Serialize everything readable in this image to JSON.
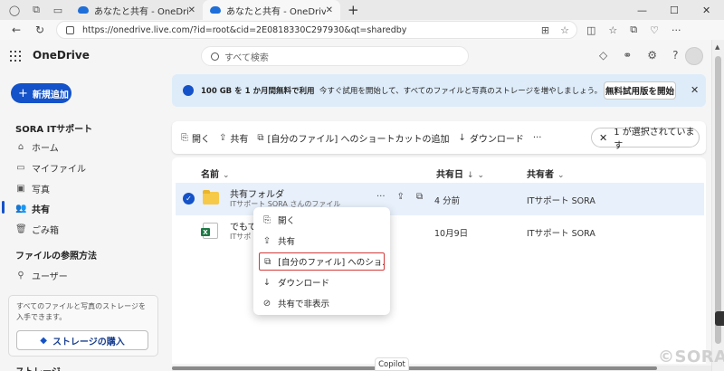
{
  "browser": {
    "tabs": [
      {
        "title": "あなたと共有 - OneDrive",
        "active": false
      },
      {
        "title": "あなたと共有 - OneDrive",
        "active": true
      }
    ],
    "new_tab": "+",
    "url": "https://onedrive.live.com/?id=root&cid=2E0818330C297930&qt=sharedby",
    "window": {
      "min": "—",
      "max": "☐",
      "close": "✕"
    }
  },
  "app": {
    "brand": "OneDrive",
    "search_placeholder": "すべて検索"
  },
  "sidebar": {
    "new_button": "新規追加",
    "account_header": "SORA ITサポート",
    "items": [
      {
        "label": "ホーム",
        "icon": "home-icon"
      },
      {
        "label": "マイファイル",
        "icon": "folder-icon"
      },
      {
        "label": "写真",
        "icon": "photo-icon"
      },
      {
        "label": "共有",
        "icon": "people-icon",
        "active": true
      },
      {
        "label": "ごみ箱",
        "icon": "trash-icon"
      }
    ],
    "browse_header": "ファイルの参照方法",
    "browse_items": [
      {
        "label": "ユーザー",
        "icon": "person-icon"
      }
    ],
    "promo": {
      "text": "すべてのファイルと写真のストレージを入手できます。",
      "button": "ストレージの購入"
    },
    "storage_header": "ストレージ"
  },
  "banner": {
    "bold": "100 GB を 1 か月間無料で利用",
    "text": "今すぐ試用を開始して、すべてのファイルと写真のストレージを増やしましょう。",
    "cta": "無料試用版を開始",
    "close": "✕"
  },
  "commandbar": {
    "open": "開く",
    "share": "共有",
    "shortcut": "[自分のファイル] へのショートカットの追加",
    "download": "ダウンロード",
    "more": "···",
    "selection": "1 が選択されています"
  },
  "list": {
    "columns": {
      "name": "名前",
      "shared_date": "共有日",
      "sharer": "共有者"
    },
    "rows": [
      {
        "name": "共有フォルダ",
        "sub": "ITサポート SORA さんのファイル",
        "date": "4 分前",
        "sharer": "ITサポート SORA",
        "type": "folder",
        "selected": true
      },
      {
        "name": "でもで",
        "sub": "ITサポ",
        "date": "10月9日",
        "sharer": "ITサポート SORA",
        "type": "excel",
        "selected": false
      }
    ]
  },
  "context_menu": {
    "items": [
      {
        "label": "開く",
        "icon": "open-icon"
      },
      {
        "label": "共有",
        "icon": "share-icon"
      },
      {
        "label": "[自分のファイル] へのショ...",
        "icon": "shortcut-icon",
        "highlighted": true
      },
      {
        "label": "ダウンロード",
        "icon": "download-icon"
      },
      {
        "label": "共有で非表示",
        "icon": "hide-icon"
      }
    ]
  },
  "copilot": "Copilot",
  "watermark": "©SORA"
}
